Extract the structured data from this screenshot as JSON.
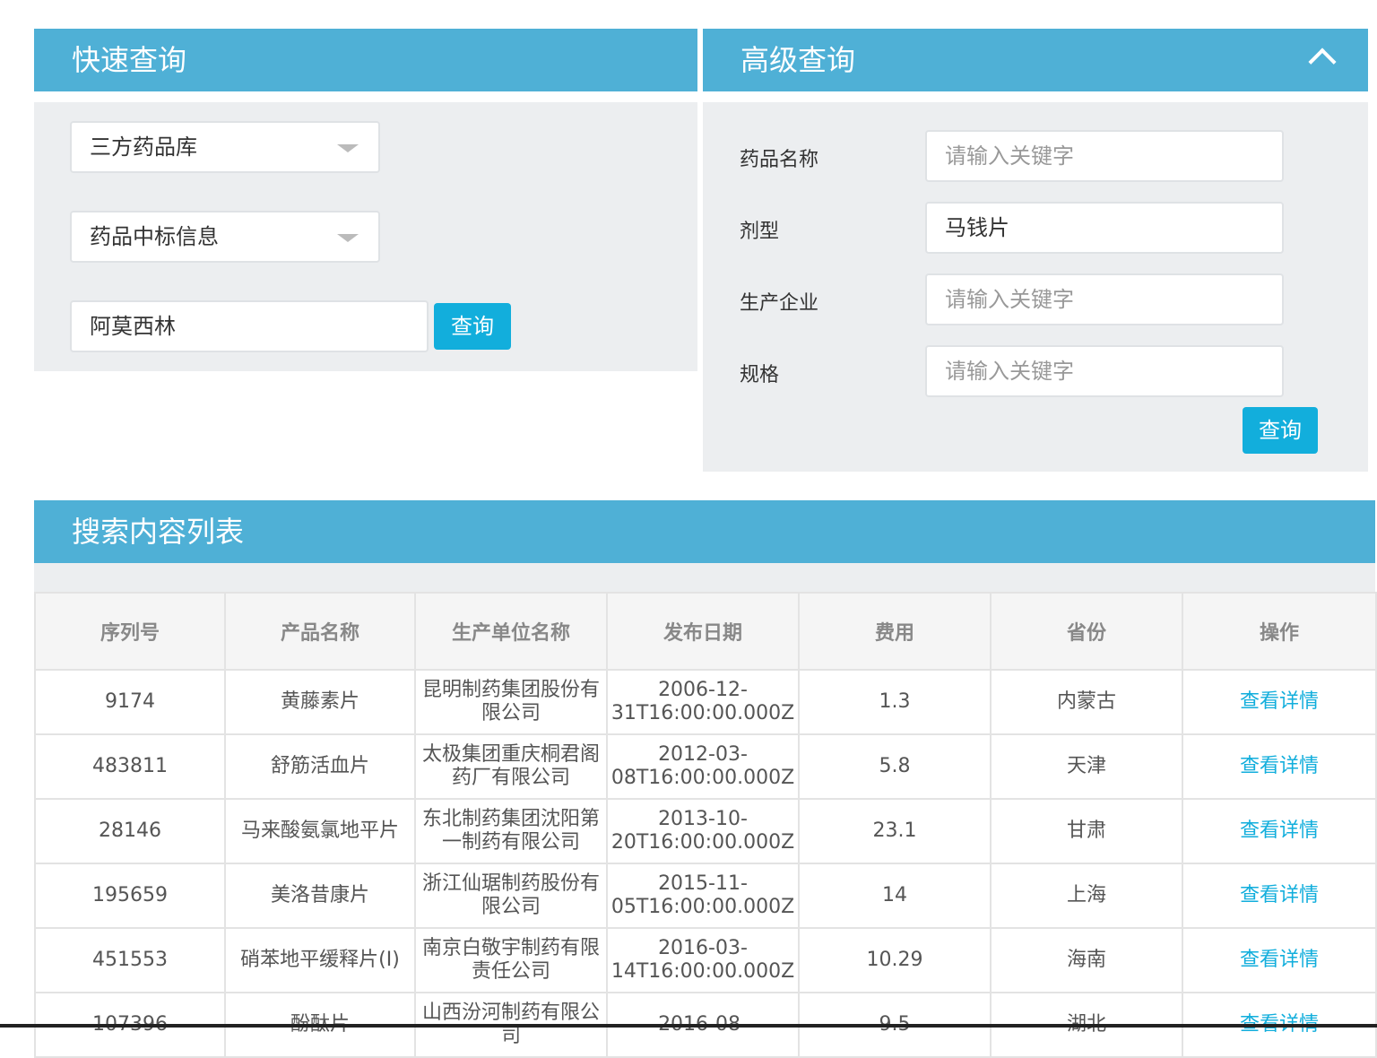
{
  "quick_query": {
    "title": "快速查询",
    "library_select": "三方药品库",
    "info_select": "药品中标信息",
    "keyword_value": "阿莫西林",
    "search_button": "查询"
  },
  "advanced_query": {
    "title": "高级查询",
    "fields": {
      "drug_name": {
        "label": "药品名称",
        "placeholder": "请输入关键字",
        "value": ""
      },
      "dosage_form": {
        "label": "剂型",
        "placeholder": "请输入关键字",
        "value": "马钱片"
      },
      "manufacturer": {
        "label": "生产企业",
        "placeholder": "请输入关键字",
        "value": ""
      },
      "spec": {
        "label": "规格",
        "placeholder": "请输入关键字",
        "value": ""
      }
    },
    "search_button": "查询"
  },
  "results": {
    "title": "搜索内容列表",
    "columns": [
      "序列号",
      "产品名称",
      "生产单位名称",
      "发布日期",
      "费用",
      "省份",
      "操作"
    ],
    "rows": [
      [
        "9174",
        "黄藤素片",
        "昆明制药集团股份有限公司",
        "2006-12-31T16:00:00.000Z",
        "1.3",
        "内蒙古",
        "查看详情"
      ],
      [
        "483811",
        "舒筋活血片",
        "太极集团重庆桐君阁药厂有限公司",
        "2012-03-08T16:00:00.000Z",
        "5.8",
        "天津",
        "查看详情"
      ],
      [
        "28146",
        "马来酸氨氯地平片",
        "东北制药集团沈阳第一制药有限公司",
        "2013-10-20T16:00:00.000Z",
        "23.1",
        "甘肃",
        "查看详情"
      ],
      [
        "195659",
        "美洛昔康片",
        "浙江仙琚制药股份有限公司",
        "2015-11-05T16:00:00.000Z",
        "14",
        "上海",
        "查看详情"
      ],
      [
        "451553",
        "硝苯地平缓释片(I)",
        "南京白敬宇制药有限责任公司",
        "2016-03-14T16:00:00.000Z",
        "10.29",
        "海南",
        "查看详情"
      ],
      [
        "107396",
        "酚酞片",
        "山西汾河制药有限公司",
        "2016-08-",
        "9.5",
        "湖北",
        "查看详情"
      ]
    ]
  }
}
